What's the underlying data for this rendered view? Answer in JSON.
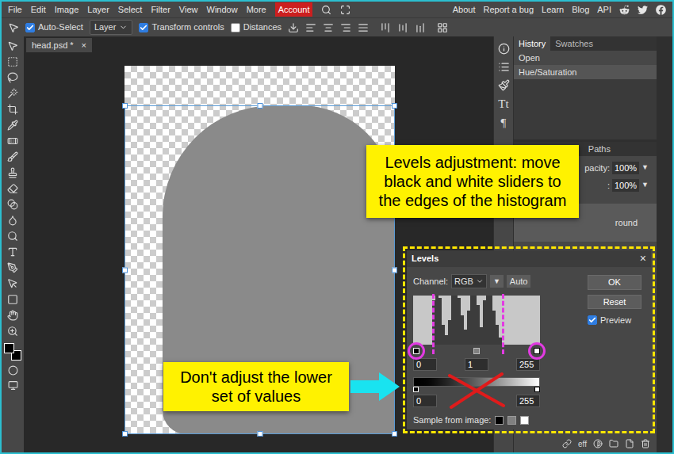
{
  "menu": {
    "items": [
      {
        "label": "File",
        "accent": false
      },
      {
        "label": "Edit",
        "accent": false
      },
      {
        "label": "Image",
        "accent": false
      },
      {
        "label": "Layer",
        "accent": false
      },
      {
        "label": "Select",
        "accent": false
      },
      {
        "label": "Filter",
        "accent": false
      },
      {
        "label": "View",
        "accent": false
      },
      {
        "label": "Window",
        "accent": false
      },
      {
        "label": "More",
        "accent": false
      },
      {
        "label": "Account",
        "accent": true
      }
    ],
    "links": [
      "About",
      "Report a bug",
      "Learn",
      "Blog",
      "API"
    ]
  },
  "options_bar": {
    "auto_select": {
      "label": "Auto-Select",
      "checked": true
    },
    "target": "Layer",
    "transform_controls": {
      "label": "Transform controls",
      "checked": true
    },
    "distances": {
      "label": "Distances",
      "checked": false
    }
  },
  "document_tab": {
    "label": "head.psd *",
    "close": "×"
  },
  "color_swatches": [
    {
      "name": "foreground",
      "color": "#000000"
    },
    {
      "name": "background",
      "color": "#000000"
    }
  ],
  "side_icons": [
    "Tt",
    "¶"
  ],
  "history_panel": {
    "tabs": [
      {
        "label": "History",
        "selected": true
      },
      {
        "label": "Swatches",
        "selected": false
      }
    ],
    "items": [
      {
        "label": "Open",
        "selected": false
      },
      {
        "label": "Hue/Saturation",
        "selected": true
      }
    ]
  },
  "layers_panel": {
    "tabs": [
      {
        "label": "Paths",
        "selected": false
      }
    ],
    "opacity": {
      "label": "pacity:",
      "value": "100%",
      "arrow": "▼"
    },
    "fill": {
      "label": ":",
      "value": "100%",
      "arrow": "▼"
    },
    "layers": [
      {
        "name": "round",
        "selected": true
      }
    ],
    "footer": {
      "effects": "eff"
    }
  },
  "levels_dialog": {
    "title": "Levels",
    "close": "×",
    "channel_label": "Channel:",
    "channel": "RGB",
    "menu_button": "▼",
    "auto_button": "Auto",
    "histogram": [
      0,
      0,
      0,
      0,
      0,
      0,
      0.9,
      1,
      0.95,
      0.4,
      0.2,
      0.5,
      1,
      1,
      0.95,
      0.6,
      0.3,
      0.7,
      1,
      1,
      0.8,
      0.35,
      0.9,
      1,
      1,
      0.7,
      0.4,
      0.15,
      0,
      0,
      0,
      0,
      0,
      0,
      0,
      0,
      0,
      0,
      0,
      0
    ],
    "input_levels": [
      "0",
      "1",
      "255"
    ],
    "output_levels": [
      "0",
      "255"
    ],
    "sample_label": "Sample from image:",
    "sample_swatches": [
      {
        "color": "#000000"
      },
      {
        "color": "#808080"
      },
      {
        "color": "#ffffff"
      }
    ],
    "buttons": [
      "OK",
      "Reset"
    ],
    "preview": {
      "label": "Preview",
      "checked": true
    }
  },
  "callouts": [
    "Levels adjustment: move black and white sliders to the edges of the histogram",
    "Don't adjust the lower set of values"
  ]
}
